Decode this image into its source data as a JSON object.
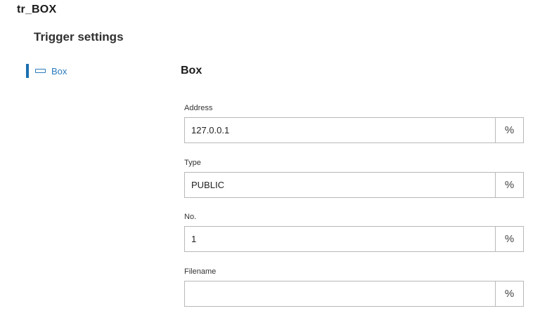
{
  "app": {
    "title": "tr_BOX"
  },
  "section": {
    "title": "Trigger settings"
  },
  "nav": {
    "items": [
      {
        "label": "Box",
        "icon": "box-icon",
        "selected": true
      }
    ],
    "accent_color": "#1a6fb0"
  },
  "panel": {
    "title": "Box",
    "fields": [
      {
        "label": "Address",
        "value": "127.0.0.1",
        "variable_button": "%"
      },
      {
        "label": "Type",
        "value": "PUBLIC",
        "variable_button": "%"
      },
      {
        "label": "No.",
        "value": "1",
        "variable_button": "%"
      },
      {
        "label": "Filename",
        "value": "",
        "variable_button": "%"
      }
    ]
  }
}
